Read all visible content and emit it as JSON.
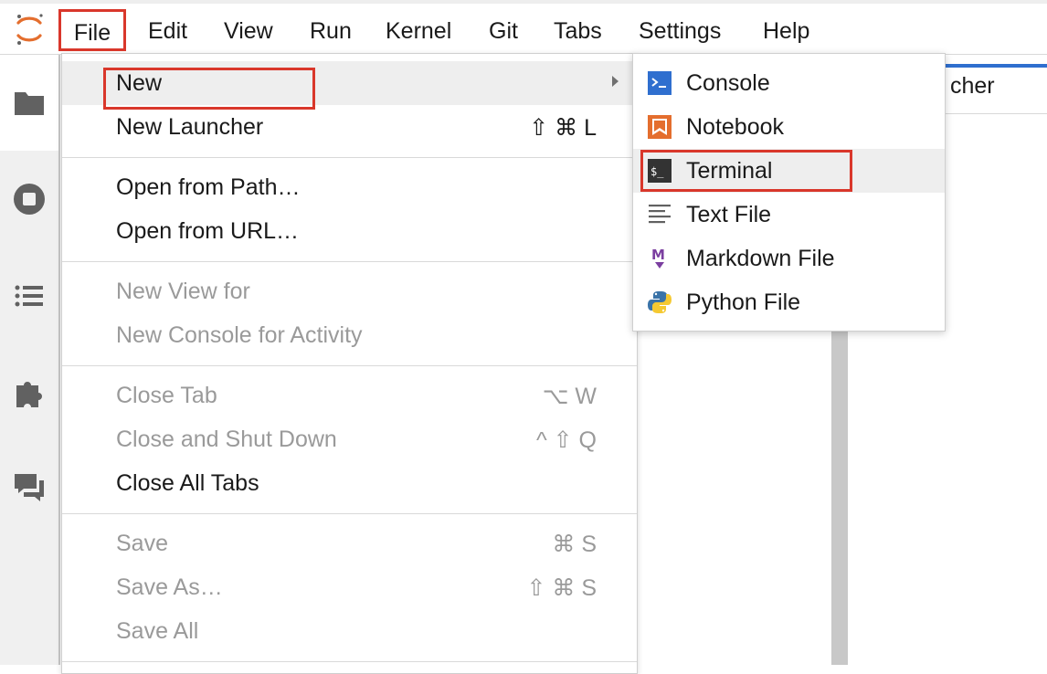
{
  "menubar": {
    "items": [
      "File",
      "Edit",
      "View",
      "Run",
      "Kernel",
      "Git",
      "Tabs",
      "Settings",
      "Help"
    ]
  },
  "background_tab": {
    "label": "cher"
  },
  "file_menu": {
    "new": "New",
    "new_launcher": "New Launcher",
    "new_launcher_shortcut": "⇧ ⌘ L",
    "open_from_path": "Open from Path…",
    "open_from_url": "Open from URL…",
    "new_view_for": "New View for",
    "new_console_for_activity": "New Console for Activity",
    "close_tab": "Close Tab",
    "close_tab_shortcut": "⌥ W",
    "close_and_shut_down": "Close and Shut Down",
    "close_and_shut_down_shortcut": "^ ⇧ Q",
    "close_all_tabs": "Close All Tabs",
    "save": "Save",
    "save_shortcut": "⌘ S",
    "save_as": "Save As…",
    "save_as_shortcut": "⇧ ⌘ S",
    "save_all": "Save All"
  },
  "new_submenu": {
    "items": [
      "Console",
      "Notebook",
      "Terminal",
      "Text File",
      "Markdown File",
      "Python File"
    ]
  },
  "colors": {
    "highlight_border": "#d9372b",
    "console_icon": "#2f6fcf",
    "notebook_icon": "#e46e2e",
    "markdown_icon": "#7b3fa0",
    "accent_tab": "#2f6fcf"
  }
}
